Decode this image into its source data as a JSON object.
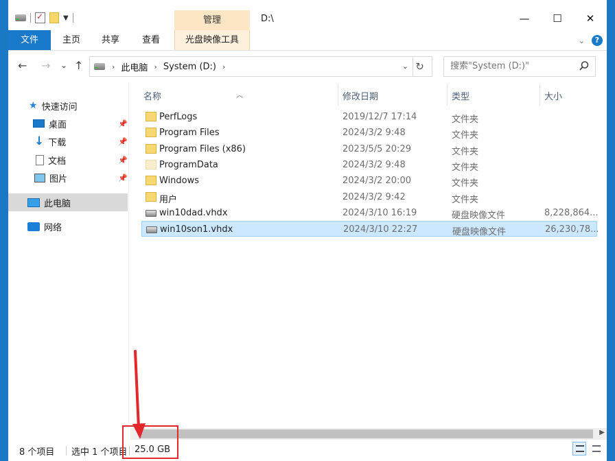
{
  "window": {
    "title": "D:\\"
  },
  "titlebar": {
    "contextual_group": "管理",
    "buttons": {
      "minimize": "—",
      "maximize": "☐",
      "close": "✕"
    }
  },
  "ribbon": {
    "tabs": [
      "文件",
      "主页",
      "共享",
      "查看",
      "光盘映像工具"
    ],
    "colors": {
      "file_tab": "#1979ca",
      "contextual": "#fce6c3"
    }
  },
  "nav": {
    "back": "←",
    "forward": "→",
    "recent": "⌄",
    "up": "↑",
    "breadcrumb": [
      "此电脑",
      "System (D:)"
    ],
    "refresh": "↻",
    "search_placeholder": "搜索\"System (D:)\""
  },
  "navpane": {
    "quick_access": "快速访问",
    "items": [
      "桌面",
      "下载",
      "文档",
      "图片"
    ],
    "this_pc": "此电脑",
    "network": "网络"
  },
  "columns": {
    "name": "名称",
    "date": "修改日期",
    "type": "类型",
    "size": "大小"
  },
  "files": [
    {
      "name": "PerfLogs",
      "date": "2019/12/7 17:14",
      "type": "文件夹",
      "size": "",
      "icon": "folder-icon"
    },
    {
      "name": "Program Files",
      "date": "2024/3/2 9:48",
      "type": "文件夹",
      "size": "",
      "icon": "folder-icon"
    },
    {
      "name": "Program Files (x86)",
      "date": "2023/5/5 20:29",
      "type": "文件夹",
      "size": "",
      "icon": "folder-icon"
    },
    {
      "name": "ProgramData",
      "date": "2024/3/2 9:48",
      "type": "文件夹",
      "size": "",
      "icon": "folder-hidden-icon"
    },
    {
      "name": "Windows",
      "date": "2024/3/2 20:00",
      "type": "文件夹",
      "size": "",
      "icon": "folder-icon"
    },
    {
      "name": "用户",
      "date": "2024/3/2 9:42",
      "type": "文件夹",
      "size": "",
      "icon": "folder-icon"
    },
    {
      "name": "win10dad.vhdx",
      "date": "2024/3/10 16:19",
      "type": "硬盘映像文件",
      "size": "8,228,864...",
      "icon": "disk-image-icon"
    },
    {
      "name": "win10son1.vhdx",
      "date": "2024/3/10 22:27",
      "type": "硬盘映像文件",
      "size": "26,230,78...",
      "icon": "disk-image-icon",
      "selected": true
    }
  ],
  "status": {
    "count": "8 个项目",
    "selected": "选中 1 个项目",
    "size": "25.0 GB"
  },
  "annotation": {
    "color": "#e4262d"
  }
}
